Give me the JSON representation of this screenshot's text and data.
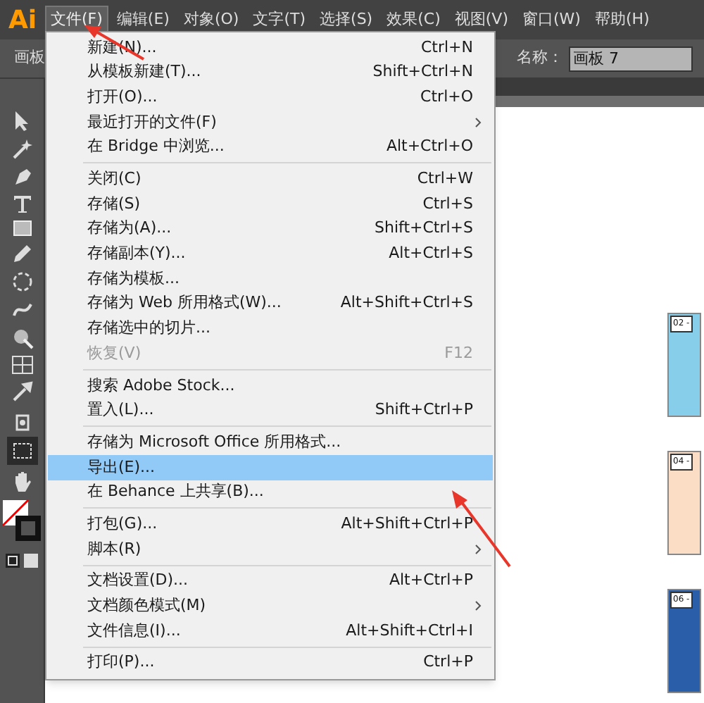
{
  "app_logo": "Ai",
  "menubar": [
    {
      "label": "文件(F)",
      "selected": true
    },
    {
      "label": "编辑(E)",
      "selected": false
    },
    {
      "label": "对象(O)",
      "selected": false
    },
    {
      "label": "文字(T)",
      "selected": false
    },
    {
      "label": "选择(S)",
      "selected": false
    },
    {
      "label": "效果(C)",
      "selected": false
    },
    {
      "label": "视图(V)",
      "selected": false
    },
    {
      "label": "窗口(W)",
      "selected": false
    },
    {
      "label": "帮助(H)",
      "selected": false
    }
  ],
  "control_bar": {
    "panel_label": "画板",
    "name_label": "名称：",
    "name_value": "画板 7"
  },
  "file_menu": {
    "items": [
      {
        "kind": "item",
        "label": "新建(N)...",
        "shortcut": "Ctrl+N",
        "submenu": false,
        "disabled": false,
        "selected": false
      },
      {
        "kind": "item",
        "label": "从模板新建(T)...",
        "shortcut": "Shift+Ctrl+N",
        "submenu": false,
        "disabled": false,
        "selected": false
      },
      {
        "kind": "item",
        "label": "打开(O)...",
        "shortcut": "Ctrl+O",
        "submenu": false,
        "disabled": false,
        "selected": false
      },
      {
        "kind": "item",
        "label": "最近打开的文件(F)",
        "submenu": true,
        "disabled": false,
        "selected": false
      },
      {
        "kind": "item",
        "label": "在 Bridge 中浏览...",
        "shortcut": "Alt+Ctrl+O",
        "submenu": false,
        "disabled": false,
        "selected": false
      },
      {
        "kind": "separator"
      },
      {
        "kind": "item",
        "label": "关闭(C)",
        "shortcut": "Ctrl+W",
        "submenu": false,
        "disabled": false,
        "selected": false
      },
      {
        "kind": "item",
        "label": "存储(S)",
        "shortcut": "Ctrl+S",
        "submenu": false,
        "disabled": false,
        "selected": false
      },
      {
        "kind": "item",
        "label": "存储为(A)...",
        "shortcut": "Shift+Ctrl+S",
        "submenu": false,
        "disabled": false,
        "selected": false
      },
      {
        "kind": "item",
        "label": "存储副本(Y)...",
        "shortcut": "Alt+Ctrl+S",
        "submenu": false,
        "disabled": false,
        "selected": false
      },
      {
        "kind": "item",
        "label": "存储为模板...",
        "submenu": false,
        "disabled": false,
        "selected": false
      },
      {
        "kind": "item",
        "label": "存储为 Web 所用格式(W)...",
        "shortcut": "Alt+Shift+Ctrl+S",
        "submenu": false,
        "disabled": false,
        "selected": false
      },
      {
        "kind": "item",
        "label": "存储选中的切片...",
        "submenu": false,
        "disabled": false,
        "selected": false
      },
      {
        "kind": "item",
        "label": "恢复(V)",
        "shortcut": "F12",
        "submenu": false,
        "disabled": true,
        "selected": false
      },
      {
        "kind": "separator"
      },
      {
        "kind": "item",
        "label": "搜索 Adobe Stock...",
        "submenu": false,
        "disabled": false,
        "selected": false
      },
      {
        "kind": "item",
        "label": "置入(L)...",
        "shortcut": "Shift+Ctrl+P",
        "submenu": false,
        "disabled": false,
        "selected": false
      },
      {
        "kind": "separator"
      },
      {
        "kind": "item",
        "label": "存储为 Microsoft Office 所用格式...",
        "submenu": false,
        "disabled": false,
        "selected": false
      },
      {
        "kind": "item",
        "label": "导出(E)...",
        "submenu": false,
        "disabled": false,
        "selected": true
      },
      {
        "kind": "item",
        "label": "在 Behance 上共享(B)...",
        "submenu": false,
        "disabled": false,
        "selected": false
      },
      {
        "kind": "separator"
      },
      {
        "kind": "item",
        "label": "打包(G)...",
        "shortcut": "Alt+Shift+Ctrl+P",
        "submenu": false,
        "disabled": false,
        "selected": false
      },
      {
        "kind": "item",
        "label": "脚本(R)",
        "submenu": true,
        "disabled": false,
        "selected": false
      },
      {
        "kind": "separator"
      },
      {
        "kind": "item",
        "label": "文档设置(D)...",
        "shortcut": "Alt+Ctrl+P",
        "submenu": false,
        "disabled": false,
        "selected": false
      },
      {
        "kind": "item",
        "label": "文档颜色模式(M)",
        "submenu": true,
        "disabled": false,
        "selected": false
      },
      {
        "kind": "item",
        "label": "文件信息(I)...",
        "shortcut": "Alt+Shift+Ctrl+I",
        "submenu": false,
        "disabled": false,
        "selected": false
      },
      {
        "kind": "separator"
      },
      {
        "kind": "item",
        "label": "打印(P)...",
        "shortcut": "Ctrl+P",
        "submenu": false,
        "disabled": false,
        "selected": false
      }
    ]
  },
  "artboards": [
    {
      "label": "02 -",
      "color": "#87ceeb"
    },
    {
      "label": "04 -",
      "color": "#fbdcc4"
    },
    {
      "label": "06 -",
      "color": "#2a5ea8"
    }
  ]
}
